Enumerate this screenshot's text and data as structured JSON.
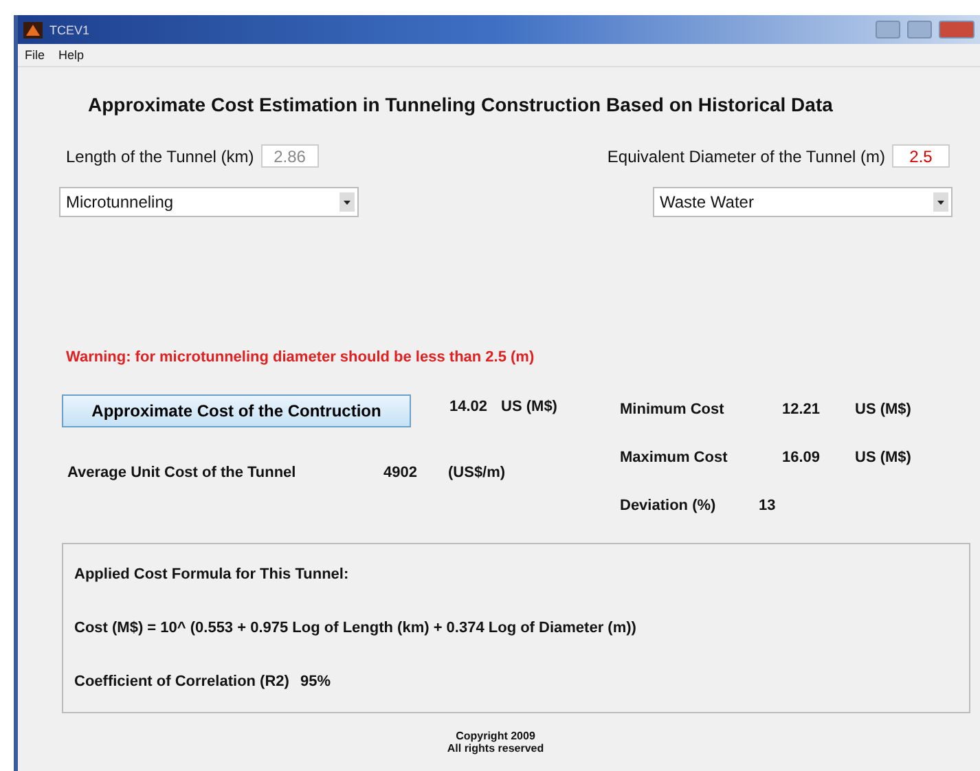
{
  "window": {
    "title": "TCEV1"
  },
  "menu": [
    "File",
    "Help"
  ],
  "heading": "Approximate Cost Estimation in Tunneling Construction Based on Historical Data",
  "length": {
    "label": "Length of the Tunnel (km)",
    "value": "2.86"
  },
  "diameter": {
    "label": "Equivalent Diameter of the Tunnel (m)",
    "value": "2.5"
  },
  "method_dropdown": {
    "value": "Microtunneling"
  },
  "usage_dropdown": {
    "value": "Waste Water"
  },
  "warning": "Warning: for microtunneling diameter should be less than 2.5 (m)",
  "estimate_button": "Approximate Cost of the Contruction",
  "cost": {
    "value": "14.02",
    "unit": "US (M$)"
  },
  "minimum": {
    "label": "Minimum Cost",
    "value": "12.21",
    "unit": "US (M$)"
  },
  "maximum": {
    "label": "Maximum Cost",
    "value": "16.09",
    "unit": "US (M$)"
  },
  "unit_cost": {
    "label": "Average Unit Cost of the Tunnel",
    "value": "4902",
    "unit": "(US$/m)"
  },
  "deviation": {
    "label": "Deviation (%)",
    "value": "13"
  },
  "formula_panel": {
    "title": "Applied Cost Formula for This Tunnel:",
    "formula": "Cost (M$) = 10^ (0.553 + 0.975 Log of Length (km) + 0.374 Log of Diameter (m))",
    "correlation_label": "Coefficient of Correlation (R2)",
    "correlation_value": "95%"
  },
  "footer": [
    "Copyright 2009",
    "All rights reserved"
  ]
}
